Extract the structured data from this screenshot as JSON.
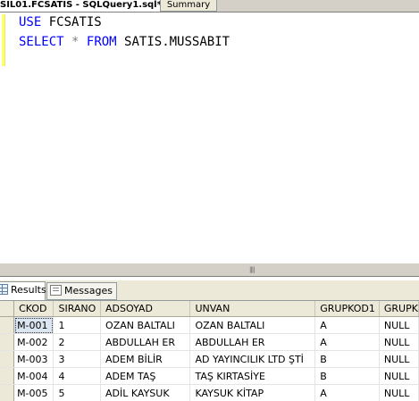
{
  "tabs": {
    "active_label": "SIL01.FCSATIS - SQLQuery1.sql*",
    "summary_label": "Summary"
  },
  "editor": {
    "lines": [
      {
        "kw": "USE",
        "rest": "FCSATIS"
      },
      {
        "kw1": "SELECT",
        "op": "*",
        "kw2": "FROM",
        "rest": "SATIS.MUSSABIT"
      }
    ]
  },
  "results_tabs": {
    "results_label": "Results",
    "messages_label": "Messages"
  },
  "grid": {
    "columns": [
      "CKOD",
      "SIRANO",
      "ADSOYAD",
      "UNVAN",
      "GRUPKOD1",
      "GRUPK"
    ],
    "rows": [
      [
        "M-001",
        "1",
        "OZAN BALTALI",
        "OZAN BALTALI",
        "A",
        "NULL"
      ],
      [
        "M-002",
        "2",
        "ABDULLAH ER",
        "ABDULLAH ER",
        "A",
        "NULL"
      ],
      [
        "M-003",
        "3",
        "ADEM BİLİR",
        "AD YAYINCILIK LTD ŞTİ",
        "B",
        "NULL"
      ],
      [
        "M-004",
        "4",
        "ADEM TAŞ",
        "TAŞ KIRTASİYE",
        "B",
        "NULL"
      ],
      [
        "M-005",
        "5",
        "ADİL KAYSUK",
        "KAYSUK KİTAP",
        "A",
        "NULL"
      ]
    ]
  },
  "colors": {
    "keyword": "#0000ff",
    "operator": "#808080",
    "changed_line_marker": "#ffff66"
  }
}
